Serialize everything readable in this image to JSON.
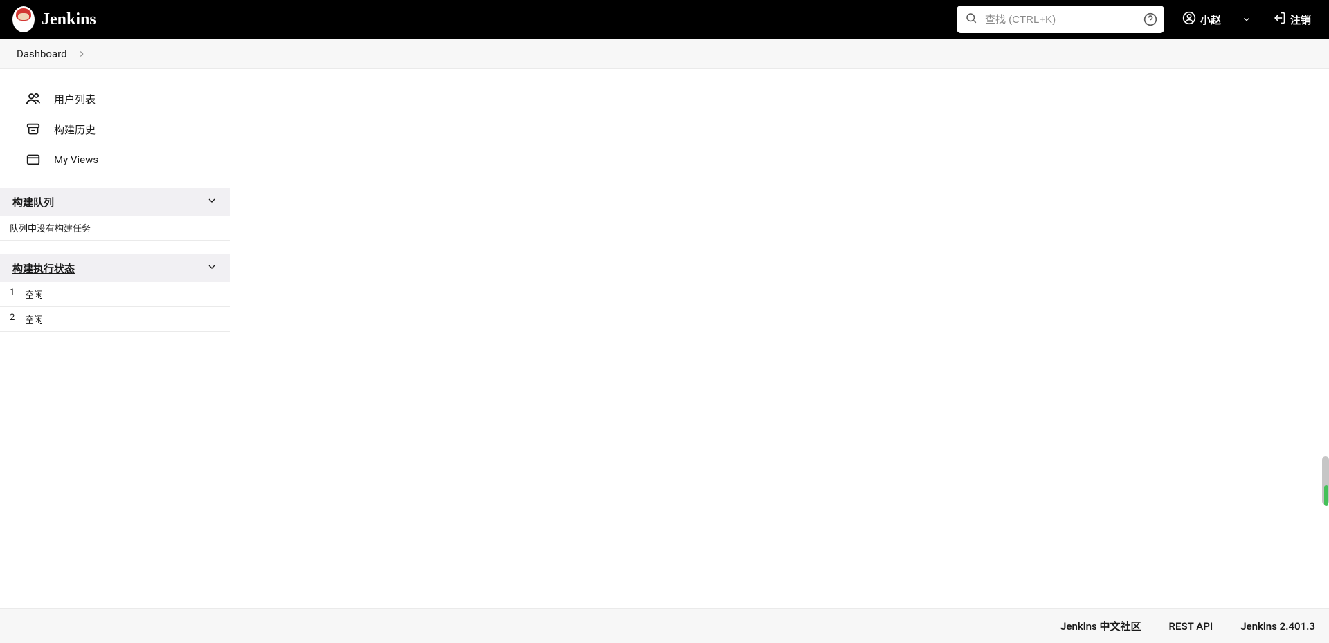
{
  "header": {
    "app_name": "Jenkins",
    "search_placeholder": "查找 (CTRL+K)",
    "user_name": "小赵",
    "logout_label": "注销"
  },
  "breadcrumb": {
    "dashboard_label": "Dashboard"
  },
  "sidebar": {
    "items": [
      {
        "label": "用户列表"
      },
      {
        "label": "构建历史"
      },
      {
        "label": "My Views"
      }
    ]
  },
  "build_queue": {
    "title": "构建队列",
    "empty_text": "队列中没有构建任务"
  },
  "executors": {
    "title": "构建执行状态",
    "rows": [
      {
        "num": "1",
        "status": "空闲"
      },
      {
        "num": "2",
        "status": "空闲"
      }
    ]
  },
  "footer": {
    "community_label": "Jenkins 中文社区",
    "rest_api_label": "REST API",
    "version_label": "Jenkins 2.401.3"
  }
}
